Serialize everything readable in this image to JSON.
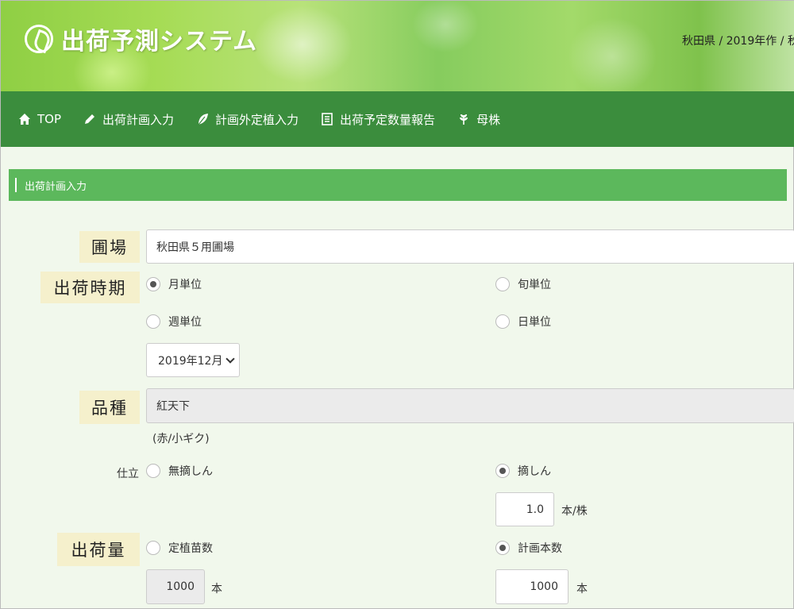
{
  "header": {
    "title": "出荷予測システム",
    "info": "秋田県 / 2019年作 / 秋"
  },
  "nav": {
    "items": [
      {
        "label": "TOP",
        "icon": "home-icon"
      },
      {
        "label": "出荷計画入力",
        "icon": "pencil-icon"
      },
      {
        "label": "計画外定植入力",
        "icon": "leaf-icon"
      },
      {
        "label": "出荷予定数量報告",
        "icon": "document-icon"
      },
      {
        "label": "母株",
        "icon": "plant-icon"
      }
    ]
  },
  "section": {
    "title": "出荷計画入力"
  },
  "form": {
    "farm": {
      "label": "圃場",
      "value": "秋田県５用圃場"
    },
    "period": {
      "label": "出荷時期",
      "options": [
        {
          "label": "月単位",
          "checked": true
        },
        {
          "label": "旬単位",
          "checked": false
        },
        {
          "label": "週単位",
          "checked": false
        },
        {
          "label": "日単位",
          "checked": false
        }
      ],
      "select_value": "2019年12月"
    },
    "variety": {
      "label": "品種",
      "value": "紅天下",
      "note": "(赤/小ギク)"
    },
    "shitate": {
      "label": "仕立",
      "options": [
        {
          "label": "無摘しん",
          "checked": false
        },
        {
          "label": "摘しん",
          "checked": true
        }
      ],
      "stems_value": "1.0",
      "stems_unit": "本/株"
    },
    "quantity": {
      "label": "出荷量",
      "options": [
        {
          "label": "定植苗数",
          "checked": false
        },
        {
          "label": "計画本数",
          "checked": true
        }
      ],
      "left_value": "1000",
      "left_unit": "本",
      "right_value": "1000",
      "right_unit": "本"
    }
  },
  "colors": {
    "nav": "#3b8d3d",
    "section": "#5cb85c",
    "label_bg": "#f5f0cc",
    "page_bg": "#f1f8ec"
  }
}
